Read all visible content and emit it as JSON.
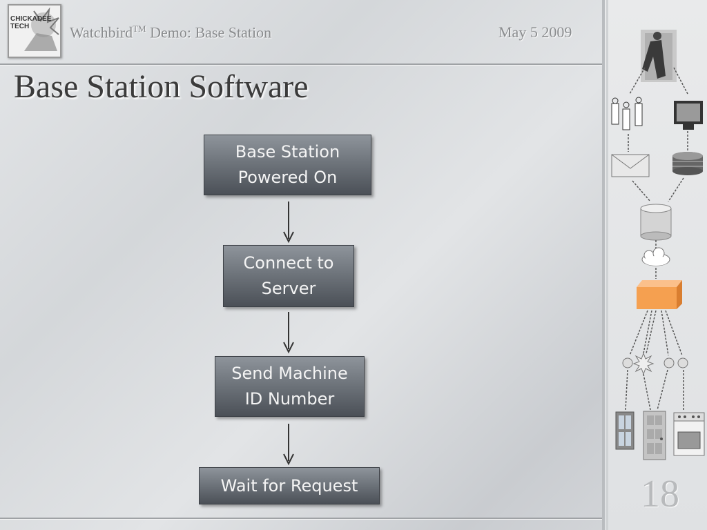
{
  "header": {
    "logo_text_line1": "CHICKADEE",
    "logo_text_line2": "TECH",
    "title": "Watchbird",
    "title_mark": "TM",
    "title_suffix": " Demo: Base Station",
    "date": "May 5 2009"
  },
  "slide": {
    "title": "Base Station Software",
    "page_number": "18"
  },
  "flow": {
    "steps": [
      {
        "line1": "Base Station",
        "line2": "Powered On"
      },
      {
        "line1": "Connect to",
        "line2": "Server"
      },
      {
        "line1": "Send Machine",
        "line2": "ID Number"
      },
      {
        "line1": "Wait for Request",
        "line2": ""
      }
    ]
  },
  "sidebar": {
    "icons": [
      "person-photo",
      "tags-icon",
      "monitor-icon",
      "envelope-icon",
      "disk-stack-icon",
      "database-icon",
      "cloud-icon",
      "base-station-box-icon",
      "sensor-icon",
      "burst-icon",
      "sensor-pair-icon",
      "window-icon",
      "door-icon",
      "stove-icon"
    ],
    "accent_color": "#f5a050"
  }
}
